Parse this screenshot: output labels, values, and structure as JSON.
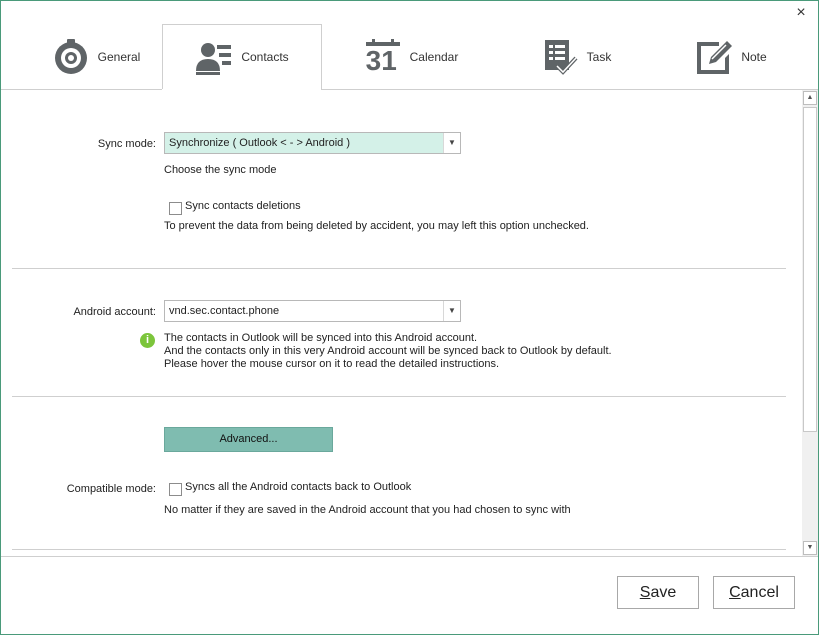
{
  "window": {
    "close_glyph": "×"
  },
  "tabs": [
    {
      "label": "General",
      "icon": "general-icon",
      "active": false
    },
    {
      "label": "Contacts",
      "icon": "contacts-icon",
      "active": true
    },
    {
      "label": "Calendar",
      "icon": "calendar-icon",
      "active": false,
      "icon_text": "31"
    },
    {
      "label": "Task",
      "icon": "task-icon",
      "active": false
    },
    {
      "label": "Note",
      "icon": "note-icon",
      "active": false
    }
  ],
  "sync": {
    "label": "Sync mode:",
    "value": "Synchronize  ( Outlook < - > Android )",
    "hint": "Choose the sync mode",
    "deletions_label": "Sync contacts deletions",
    "deletions_checked": false,
    "deletions_hint": "To prevent the data from being deleted by accident, you may left this option unchecked."
  },
  "account": {
    "label": "Android account:",
    "value": "vnd.sec.contact.phone",
    "info_lines": [
      "The contacts in Outlook will be synced into this Android account.",
      "And the contacts only in this very Android account will be synced back to Outlook by default.",
      "Please hover the mouse cursor on it to read the detailed instructions."
    ]
  },
  "advanced": {
    "label": "Advanced..."
  },
  "compatible": {
    "label": "Compatible mode:",
    "option_label": "Syncs all the Android contacts back to Outlook",
    "checked": false,
    "hint": "No matter if they are saved in the Android account that you had chosen to sync with"
  },
  "footer": {
    "save_first": "S",
    "save_rest": "ave",
    "cancel_first": "C",
    "cancel_rest": "ancel"
  },
  "colors": {
    "accent": "#7fbcb0",
    "highlight": "#d4f1e8",
    "info": "#7cc53b"
  }
}
